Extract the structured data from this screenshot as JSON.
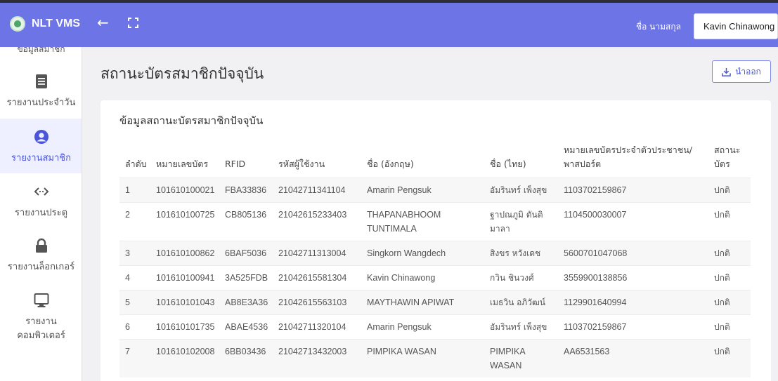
{
  "app": {
    "title": "NLT VMS"
  },
  "header": {
    "name_label": "ชื่อ นามสกุล",
    "name_value": "Kavin Chinawong"
  },
  "sidebar": {
    "cut_label": "ข้อมูลสมาชิก",
    "items": [
      {
        "label": "รายงานประจำวัน",
        "icon": "document-icon"
      },
      {
        "label": "รายงานสมาชิก",
        "icon": "user-circle-icon"
      },
      {
        "label": "รายงานประตู",
        "icon": "code-arrows-icon"
      },
      {
        "label": "รายงานล็อกเกอร์",
        "icon": "lock-icon"
      },
      {
        "label": "รายงาน คอมพิวเตอร์",
        "icon": "monitor-icon"
      }
    ]
  },
  "page": {
    "title": "สถานะบัตรสมาชิกปัจจุบัน",
    "export_label": "นำออก"
  },
  "card": {
    "title": "ข้อมูลสถานะบัตรสมาชิกปัจจุบัน"
  },
  "table": {
    "headers": [
      "ลำดับ",
      "หมายเลขบัตร",
      "RFID",
      "รหัสผู้ใช้งาน",
      "ชื่อ (อังกฤษ)",
      "ชื่อ (ไทย)",
      "หมายเลขบัตรประจำตัวประชาชน/ พาสปอร์ต",
      "สถานะบัตร"
    ],
    "rows": [
      [
        "1",
        "101610100021",
        "FBA33836",
        "21042711341104",
        "Amarin Pengsuk",
        "อัมรินทร์ เพ็งสุข",
        "1103702159867",
        "ปกติ"
      ],
      [
        "2",
        "101610100725",
        "CB805136",
        "21042615233403",
        "THAPANABHOOM TUNTIMALA",
        "ฐาปณภูมิ ตันติมาลา",
        "1104500030007",
        "ปกติ"
      ],
      [
        "3",
        "101610100862",
        "6BAF5036",
        "21042711313004",
        "Singkorn Wangdech",
        "สิงขร หวังเดช",
        "5600701047068",
        "ปกติ"
      ],
      [
        "4",
        "101610100941",
        "3A525FDB",
        "21042615581304",
        "Kavin Chinawong",
        "กวิน ชินวงศ์",
        "3559900138856",
        "ปกติ"
      ],
      [
        "5",
        "101610101043",
        "AB8E3A36",
        "21042615563103",
        "MAYTHAWIN APIWAT",
        "เมธวิน อภิวัฒน์",
        "1129901640994",
        "ปกติ"
      ],
      [
        "6",
        "101610101735",
        "ABAE4536",
        "21042711320104",
        "Amarin Pengsuk",
        "อัมรินทร์ เพ็งสุข",
        "1103702159867",
        "ปกติ"
      ],
      [
        "7",
        "101610102008",
        "6BB03436",
        "21042713432003",
        "PIMPIKA WASAN",
        "PIMPIKA WASAN",
        "AA6531563",
        "ปกติ"
      ]
    ]
  },
  "colors": {
    "topbar": "#6c74e6",
    "accent": "#4b57d8"
  }
}
